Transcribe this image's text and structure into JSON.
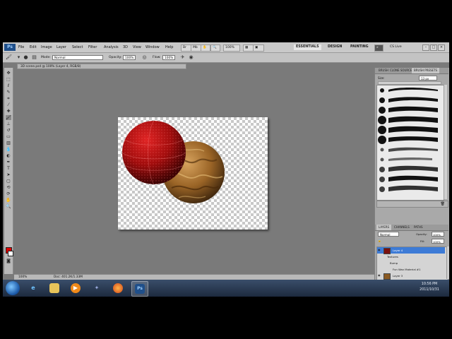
{
  "app": {
    "logo": "Ps",
    "menu": [
      "File",
      "Edit",
      "Image",
      "Layer",
      "Select",
      "Filter",
      "Analysis",
      "3D",
      "View",
      "Window",
      "Help"
    ],
    "zoom": "100%",
    "workspaces": [
      "ESSENTIALS",
      "DESIGN",
      "PAINTING"
    ],
    "cs_live": "CS Live",
    "window_controls": [
      "–",
      "□",
      "×"
    ]
  },
  "options": {
    "mode_label": "Mode:",
    "mode_value": "Normal",
    "opacity_label": "Opacity:",
    "opacity_value": "100%",
    "flow_label": "Flow:",
    "flow_value": "100%"
  },
  "document": {
    "tab_title": "3D scene.psd @ 100% (Layer 4, RGB/8)",
    "status_zoom": "100%",
    "status_doc": "Doc: 401.2K/1.33M"
  },
  "brush_panel": {
    "tabs": [
      "BRUSH",
      "CLONE SOURCE",
      "BRUSH PRESETS"
    ],
    "size_label": "Size:",
    "size_value": "13 px",
    "presets": [
      "",
      "",
      "",
      "",
      "",
      "",
      "",
      "",
      "",
      "",
      "",
      ""
    ]
  },
  "layers_panel": {
    "tabs": [
      "LAYERS",
      "CHANNELS",
      "PATHS"
    ],
    "blend": "Normal",
    "opacity_label": "Opacity:",
    "opacity_value": "100%",
    "fill_label": "Fill:",
    "fill_value": "100%",
    "layers": [
      {
        "name": "Layer 4",
        "selected": true
      },
      {
        "name": "Textures",
        "selected": false
      },
      {
        "name": "Bump",
        "selected": false
      },
      {
        "name": "Fun Wav Material #1",
        "selected": false
      },
      {
        "name": "Layer 3",
        "selected": false
      }
    ]
  },
  "taskbar": {
    "photoshop": "Ps",
    "time": "10:56 PM",
    "date": "2011/10/31"
  },
  "colors": {
    "foreground": "#e00000",
    "background": "#ffffff",
    "selected_layer": "#3d7bd6"
  }
}
